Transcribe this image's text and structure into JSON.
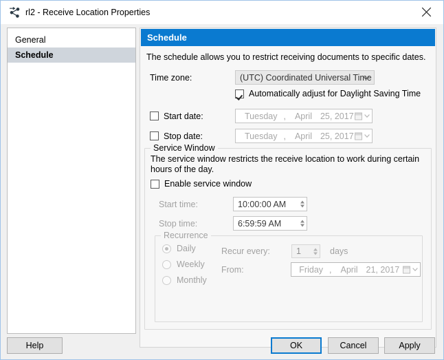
{
  "window": {
    "title": "rl2 - Receive Location Properties",
    "icon": "receive-location-icon",
    "close_icon": "close-icon",
    "accent_color": "#0a7ad0"
  },
  "sidebar": {
    "items": [
      {
        "label": "General",
        "selected": false
      },
      {
        "label": "Schedule",
        "selected": true
      }
    ]
  },
  "pane": {
    "header": "Schedule",
    "description": "The schedule allows you to restrict receiving documents to specific dates.",
    "timezone": {
      "label": "Time zone:",
      "value": "(UTC) Coordinated Universal Time",
      "chevron_icon": "chevron-down-icon"
    },
    "dst": {
      "label": "Automatically adjust for Daylight Saving Time",
      "checked": true
    },
    "start_date": {
      "label": "Start date:",
      "checked": false,
      "day": "Tuesday",
      "comma": ",",
      "month": "April",
      "date": "25, 2017",
      "calendar_icon": "calendar-icon",
      "chevron_icon": "chevron-down-icon"
    },
    "stop_date": {
      "label": "Stop date:",
      "checked": false,
      "day": "Tuesday",
      "comma": ",",
      "month": "April",
      "date": "25, 2017",
      "calendar_icon": "calendar-icon",
      "chevron_icon": "chevron-down-icon"
    }
  },
  "service_window": {
    "title": "Service Window",
    "description": "The service window restricts the receive location to work during certain hours of the day.",
    "enable": {
      "label": "Enable service window",
      "checked": false
    },
    "start_time": {
      "label": "Start time:",
      "value": "10:00:00 AM"
    },
    "stop_time": {
      "label": "Stop time:",
      "value": "6:59:59 AM"
    },
    "recurrence": {
      "title": "Recurrence",
      "options": [
        {
          "label": "Daily",
          "selected": true
        },
        {
          "label": "Weekly",
          "selected": false
        },
        {
          "label": "Monthly",
          "selected": false
        }
      ],
      "recur_every": {
        "label": "Recur every:",
        "value": "1",
        "unit": "days"
      },
      "from": {
        "label": "From:",
        "day": "Friday",
        "comma": ",",
        "month": "April",
        "date": "21, 2017",
        "calendar_icon": "calendar-icon",
        "chevron_icon": "chevron-down-icon"
      }
    }
  },
  "footer": {
    "help": "Help",
    "ok": "OK",
    "cancel": "Cancel",
    "apply": "Apply"
  }
}
